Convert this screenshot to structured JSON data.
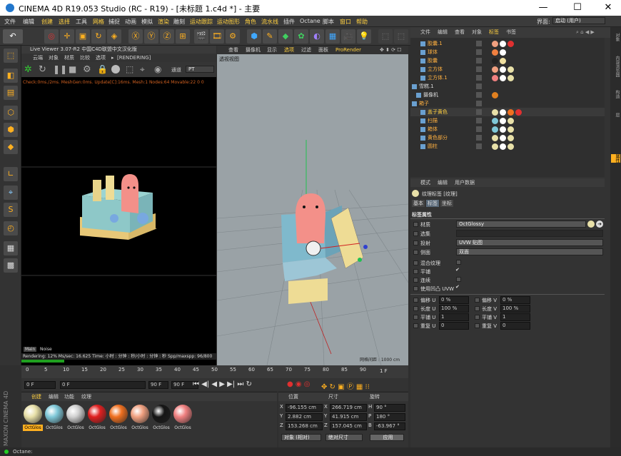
{
  "title": "CINEMA 4D R19.053 Studio (RC - R19) - [未标题 1.c4d *] - 主要",
  "window_buttons": [
    "—",
    "☐",
    "✕"
  ],
  "menu": [
    "文件",
    "编辑",
    "创建",
    "选择",
    "工具",
    "网格",
    "捕捉",
    "动画",
    "模拟",
    "渲染",
    "雕刻",
    "运动跟踪",
    "运动图形",
    "角色",
    "流水线",
    "插件",
    "Octane",
    "脚本",
    "窗口",
    "帮助"
  ],
  "layout_label": "界面:",
  "layout_value": "启动 (用户)",
  "live_viewer": {
    "title": "Live Viewer 3.07-R2 中国C4D联盟中文汉化版",
    "menu": [
      "云端",
      "对象",
      "材质",
      "比较",
      "选项",
      "▸",
      "[RENDERING]"
    ],
    "mode": "通道",
    "mode_value": "PT",
    "stats": "Check:0ms./2ms. MeshGen:0ms. Update[C]:16ms. Mesh:1 Nodes:64 Movable:22  0 0",
    "tab_main": "Main",
    "tab_noise": "Noise",
    "render_status": "Rendering: 12%  Ms/sec: 16.625  Time: 小时 : 分钟 : 秒/小时 : 分钟 : 秒  Spp/maxspp: 96/800"
  },
  "viewport": {
    "menu": [
      "查看",
      "摄像机",
      "显示",
      "选项",
      "过滤",
      "面板",
      "ProRender"
    ],
    "label": "透视视图",
    "grid_spacing": "网格间距 : 1000 cm"
  },
  "timeline": {
    "ticks": [
      "0",
      "5",
      "10",
      "15",
      "20",
      "25",
      "30",
      "35",
      "40",
      "45",
      "50",
      "55",
      "60",
      "65",
      "70",
      "75",
      "80",
      "85",
      "90"
    ],
    "current": "1 F",
    "start": "0 F",
    "fps_field": "0 F",
    "end_field": "90 F",
    "end2": "90 F"
  },
  "materials": {
    "tabs": [
      "创建",
      "编辑",
      "功能",
      "纹理"
    ],
    "items": [
      {
        "label": "OctGlos",
        "color": "#e8e0a8"
      },
      {
        "label": "OctGlos",
        "color": "#7fc8d8"
      },
      {
        "label": "OctGlos",
        "color": "#d0d0d0"
      },
      {
        "label": "OctGlos",
        "color": "#e02020"
      },
      {
        "label": "OctGlos",
        "color": "#f07020"
      },
      {
        "label": "OctGlos",
        "color": "#f0a080"
      },
      {
        "label": "OctGlos",
        "color": "#151515"
      },
      {
        "label": "OctGlos",
        "color": "#f08080"
      }
    ]
  },
  "coords": {
    "headers": [
      "位置",
      "尺寸",
      "旋转"
    ],
    "rows": [
      {
        "a": "X",
        "pos": "-96.155 cm",
        "b": "X",
        "size": "266.719 cm",
        "c": "H",
        "rot": "90 °"
      },
      {
        "a": "Y",
        "pos": "2.882 cm",
        "b": "Y",
        "size": "41.915 cm",
        "c": "P",
        "rot": "180 °"
      },
      {
        "a": "Z",
        "pos": "153.268 cm",
        "b": "Z",
        "size": "157.045 cm",
        "c": "B",
        "rot": "-63.967 °"
      }
    ],
    "mode1": "对象 (相对)",
    "mode2": "绝对尺寸",
    "apply": "应用"
  },
  "status": "Octane:",
  "maxon": "MAXON CINEMA 4D",
  "object_manager": {
    "tabs": [
      "文件",
      "编辑",
      "查看",
      "对象",
      "标签",
      "书签"
    ],
    "objects": [
      {
        "name": "胶囊.1",
        "color": "#ffb040",
        "indent": 14
      },
      {
        "name": "球体",
        "color": "#ffb040",
        "indent": 14
      },
      {
        "name": "胶囊",
        "color": "#ffb040",
        "indent": 14
      },
      {
        "name": "立方体",
        "color": "#ffb040",
        "indent": 14
      },
      {
        "name": "立方体.1",
        "color": "#ffb040",
        "indent": 14
      },
      {
        "name": "雪糕.1",
        "color": "#ddd",
        "indent": 2
      },
      {
        "name": "摄像机",
        "color": "#ddd",
        "indent": 8
      },
      {
        "name": "箱子",
        "color": "#ffb040",
        "indent": 2
      },
      {
        "name": "盖子黄色",
        "color": "#ffd040",
        "indent": 14
      },
      {
        "name": "扫描",
        "color": "#ffb040",
        "indent": 14
      },
      {
        "name": "箱体",
        "color": "#ffb040",
        "indent": 14
      },
      {
        "name": "黄色部分",
        "color": "#ffb040",
        "indent": 14
      },
      {
        "name": "圆柱",
        "color": "#ffb040",
        "indent": 14
      }
    ]
  },
  "attributes": {
    "menu": [
      "模式",
      "编辑",
      "用户数据"
    ],
    "title": "纹理标签 [纹理]",
    "tabs": [
      "基本",
      "标签",
      "坐标"
    ],
    "section": "标签属性",
    "material_label": "材质",
    "material_value": "OctGlossy",
    "selection_label": "选集",
    "projection_label": "投射",
    "projection_value": "UVW 贴图",
    "side_label": "侧面",
    "side_value": "双面",
    "mix_label": "混合纹理",
    "tile_label": "平铺",
    "seamless_label": "连续",
    "uvw_label": "使用凹凸 UVW",
    "offset_u": "偏移 U",
    "offset_u_val": "0 %",
    "offset_v": "偏移 V",
    "offset_v_val": "0 %",
    "length_u": "长度 U",
    "length_u_val": "100 %",
    "length_v": "长度 V",
    "length_v_val": "100 %",
    "tile_u": "平铺 U",
    "tile_u_val": "1",
    "tile_v": "平铺 V",
    "tile_v_val": "1",
    "repeat_u": "重复 U",
    "repeat_u_val": "0",
    "repeat_v": "重复 V",
    "repeat_v_val": "0"
  },
  "sidebar_tabs": [
    "对象",
    "内容浏览器",
    "构造",
    "层",
    "属性"
  ]
}
